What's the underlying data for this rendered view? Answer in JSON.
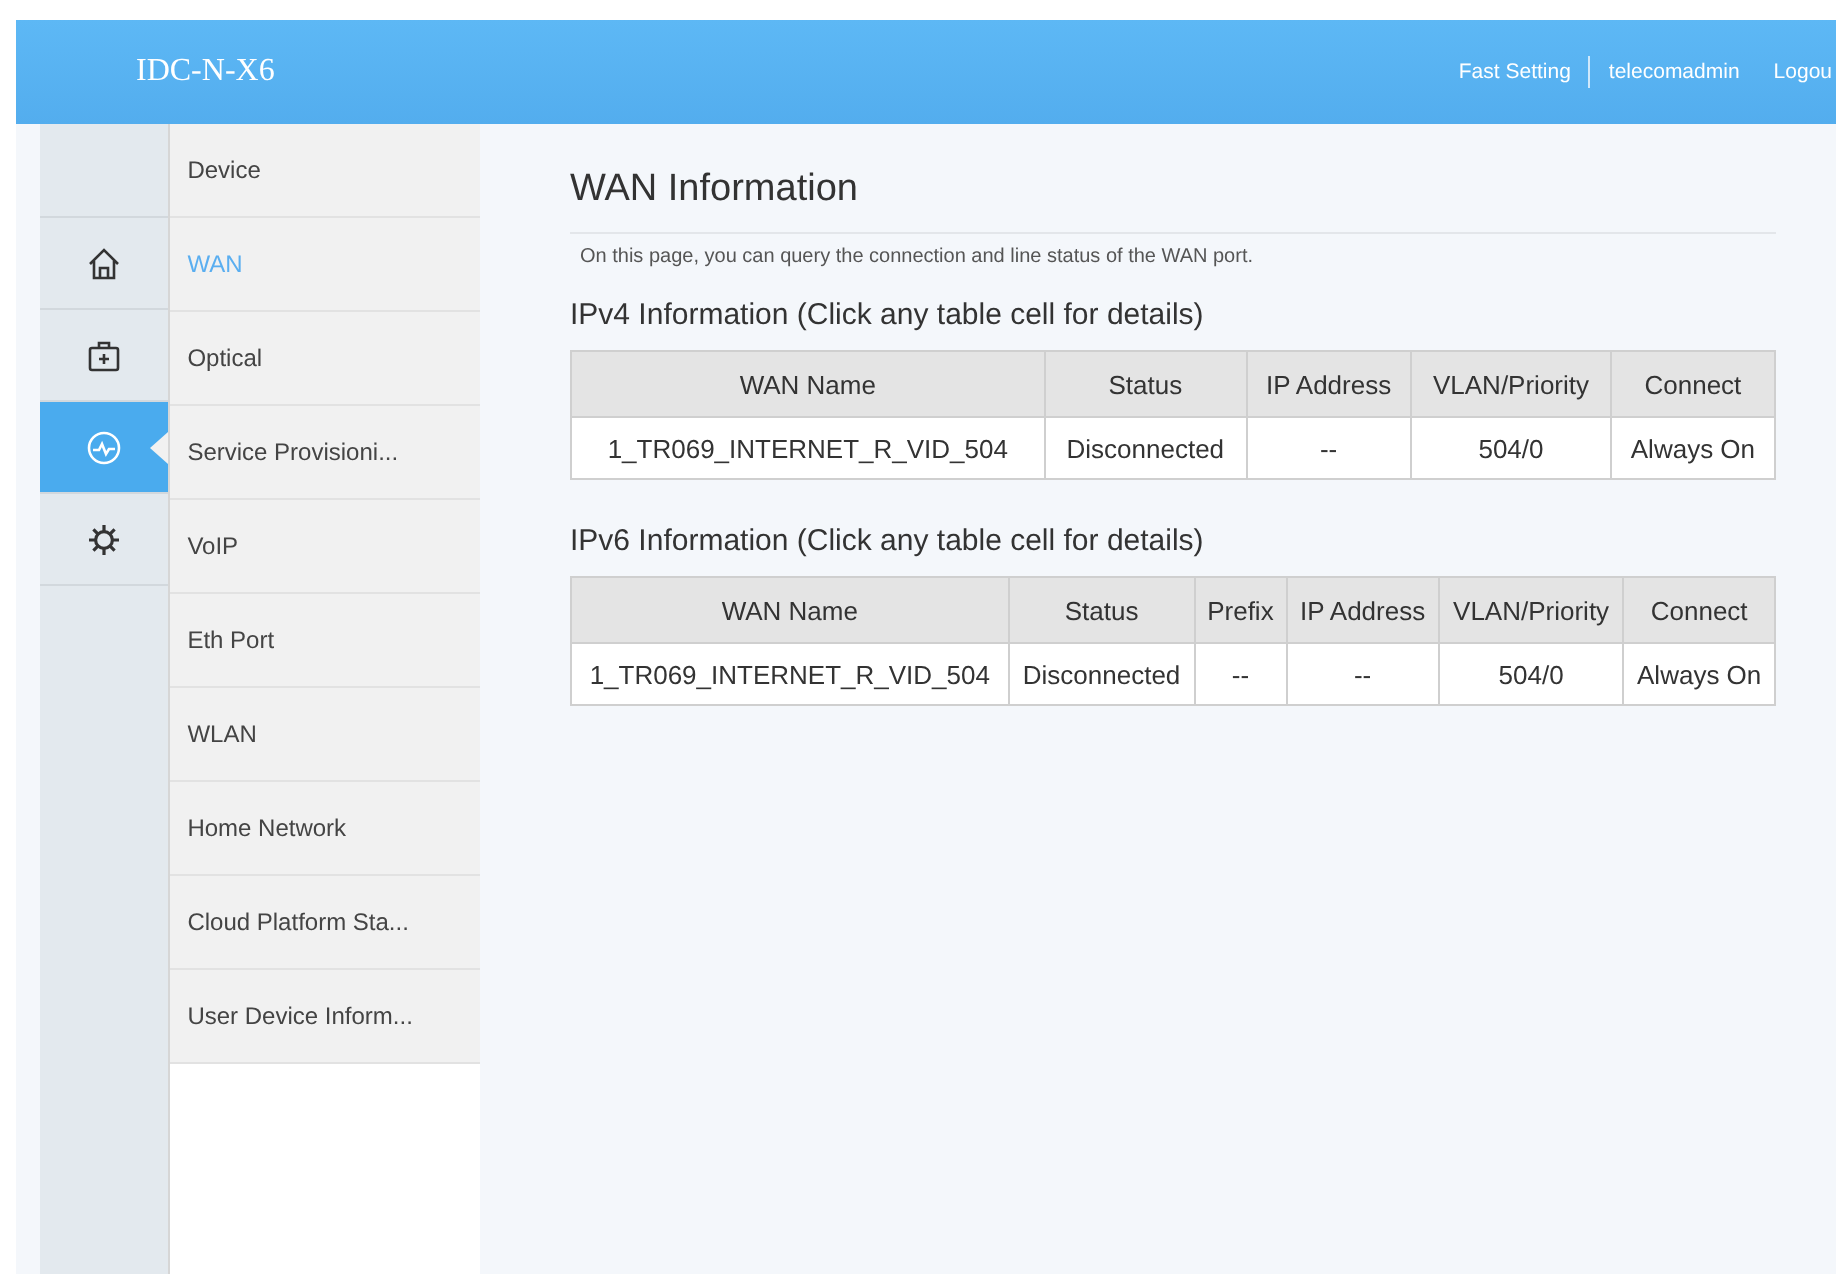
{
  "header": {
    "logo": "IDC-N-X6",
    "links": [
      {
        "label": "Fast Setting"
      },
      {
        "label": "telecomadmin"
      },
      {
        "label": "Logou"
      }
    ]
  },
  "rail": [
    {
      "kind": "home",
      "selected": false
    },
    {
      "kind": "kit",
      "selected": false
    },
    {
      "kind": "activity",
      "selected": true
    },
    {
      "kind": "gear",
      "selected": false
    }
  ],
  "menu": [
    {
      "label": "Device",
      "selected": false
    },
    {
      "label": "WAN",
      "selected": true
    },
    {
      "label": "Optical",
      "selected": false
    },
    {
      "label": "Service Provisioni...",
      "selected": false
    },
    {
      "label": "VoIP",
      "selected": false
    },
    {
      "label": "Eth Port",
      "selected": false
    },
    {
      "label": "WLAN",
      "selected": false
    },
    {
      "label": "Home Network",
      "selected": false
    },
    {
      "label": "Cloud Platform Sta...",
      "selected": false
    },
    {
      "label": "User Device Inform...",
      "selected": false
    }
  ],
  "content": {
    "title": "WAN Information",
    "description": "On this page, you can query the connection and line status of the WAN port.",
    "sections": [
      {
        "title": "IPv4 Information (Click any table cell for details)",
        "columns": [
          "WAN Name",
          "Status",
          "IP Address",
          "VLAN/Priority",
          "Connect"
        ],
        "rows": [
          [
            "1_TR069_INTERNET_R_VID_504",
            "Disconnected",
            "--",
            "504/0",
            "Always On"
          ]
        ]
      },
      {
        "title": "IPv6 Information (Click any table cell for details)",
        "columns": [
          "WAN Name",
          "Status",
          "Prefix",
          "IP Address",
          "VLAN/Priority",
          "Connect"
        ],
        "rows": [
          [
            "1_TR069_INTERNET_R_VID_504",
            "Disconnected",
            "--",
            "--",
            "504/0",
            "Always On"
          ]
        ]
      }
    ]
  }
}
